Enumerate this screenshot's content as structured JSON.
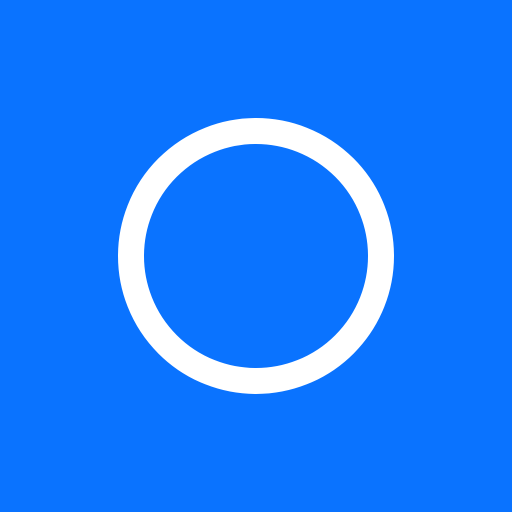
{
  "colors": {
    "background": "#0a73ff",
    "ring": "#ffffff"
  },
  "icon": {
    "name": "circle-ring-icon"
  }
}
